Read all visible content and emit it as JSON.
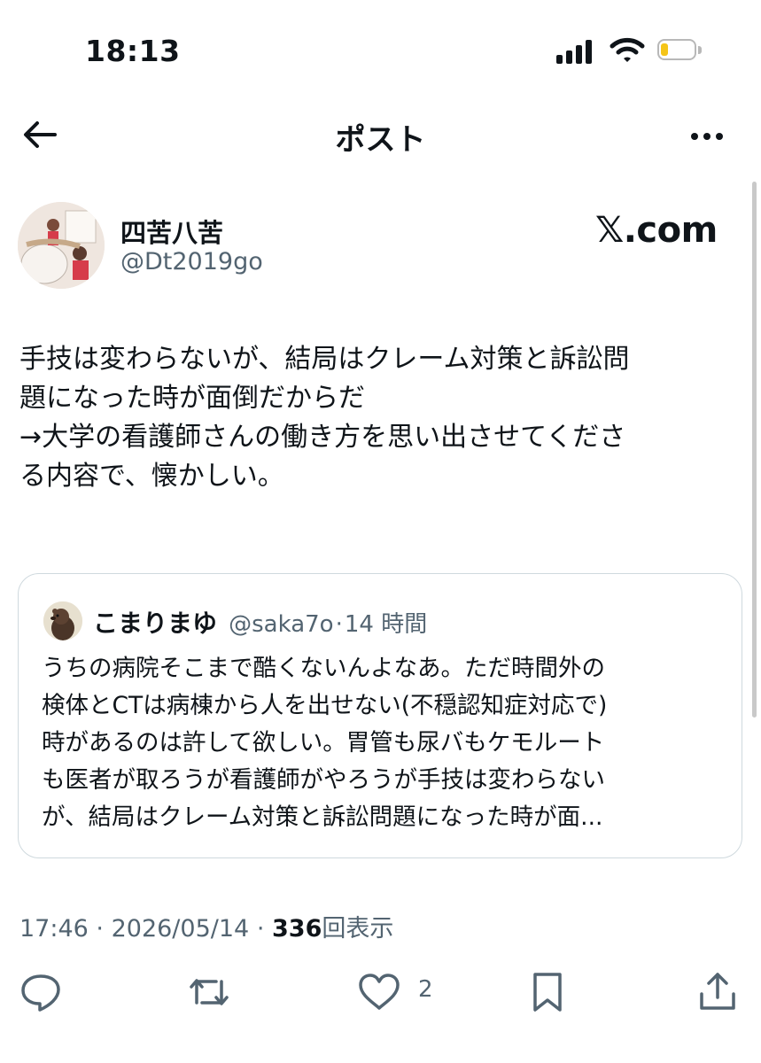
{
  "status_bar": {
    "time": "18:13"
  },
  "header": {
    "title": "ポスト"
  },
  "author": {
    "name": "四苦八苦",
    "handle": "@Dt2019go"
  },
  "watermark": "𝕏.com",
  "post": {
    "lines": [
      "手技は変わらないが、結局はクレーム対策と訴訟問",
      "題になった時が面倒だからだ",
      "→大学の看護師さんの働き方を思い出させてくださ",
      "る内容で、懐かしい。"
    ]
  },
  "quote": {
    "name": "こまりまゆ",
    "handle": "@saka7o",
    "separator": "·",
    "time": "14 時間",
    "lines": [
      "うちの病院そこまで酷くないんよなあ。ただ時間外の",
      "検体とCTは病棟から人を出せない(不穏認知症対応で)",
      "時があるのは許して欲しい。胃管も尿バもケモルート",
      "も医者が取ろうが看護師がやろうが手技は変わらない",
      "が、結局はクレーム対策と訴訟問題になった時が面..."
    ]
  },
  "meta": {
    "time": "17:46",
    "sep1": "·",
    "date": "2026/05/14",
    "sep2": "·",
    "views_count": "336",
    "views_label": "回表示"
  },
  "actions": {
    "like_count": "2"
  },
  "icons": {
    "back": "arrow-left-icon",
    "more": "more-dots-icon",
    "reply": "reply-icon",
    "repost": "repost-icon",
    "like": "heart-icon",
    "bookmark": "bookmark-icon",
    "share": "share-icon"
  }
}
